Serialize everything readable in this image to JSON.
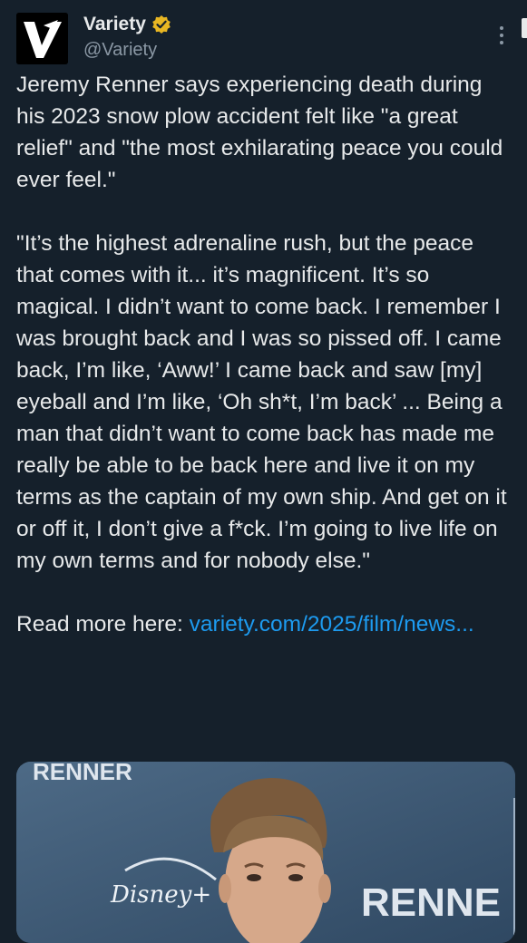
{
  "account": {
    "display_name": "Variety",
    "handle": "@Variety",
    "avatar_letter": "V",
    "verified_icon": "verified-badge-icon",
    "verified_color": "#e8b623"
  },
  "tweet": {
    "paragraph1": "Jeremy Renner says experiencing death during his 2023 snow plow accident felt like \"a great relief\" and \"the most exhilarating peace you could ever feel.\"",
    "paragraph2": "\"It’s the highest adrenaline rush, but the peace that comes with it... it’s magnificent. It’s so magical. I didn’t want to come back. I remember I was brought back and I was so pissed off. I came back, I’m like, ‘Aww!’ I came back and saw [my] eyeball and I’m like, ‘Oh sh*t, I’m back’ ... Being a man that didn’t want to come back has made me really be able to be back here and live it on my terms as the captain of my own ship. And get on it or off it, I don’t give a f*ck. I’m going to live life on my own terms and for nobody else.\"",
    "read_more_prefix": "Read more here: ",
    "link_text": "variety.com/2025/film/news..."
  },
  "media": {
    "backdrop_text_top": "RENNER",
    "backdrop_text_right": "RENNE",
    "logo_text": "Disney+"
  },
  "colors": {
    "background": "#15202b",
    "text": "#e7e9ea",
    "muted": "#8b98a5",
    "link": "#1d9bf0"
  }
}
